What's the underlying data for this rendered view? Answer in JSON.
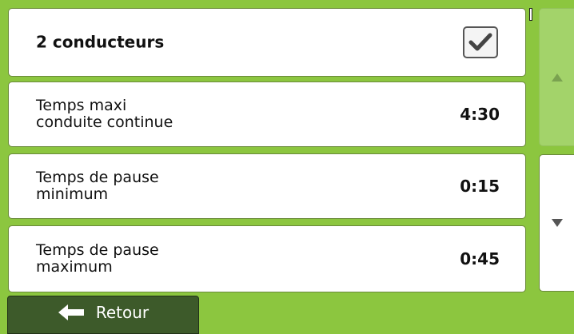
{
  "settings": {
    "rows": [
      {
        "label": "2 conducteurs",
        "type": "checkbox",
        "checked": true
      },
      {
        "label": "Temps maxi\nconduite continue",
        "type": "value",
        "value": "4:30"
      },
      {
        "label": "Temps de pause\nminimum",
        "type": "value",
        "value": "0:15"
      },
      {
        "label": "Temps de pause\nmaximum",
        "type": "value",
        "value": "0:45"
      }
    ]
  },
  "scroll": {
    "up_icon": "triangle-up-icon",
    "down_icon": "triangle-down-icon"
  },
  "footer": {
    "back_label": "Retour",
    "back_icon": "arrow-left-icon"
  },
  "colors": {
    "background": "#8cc63f",
    "back_button": "#3d5a2a",
    "scroll_up": "#a3d36a"
  }
}
